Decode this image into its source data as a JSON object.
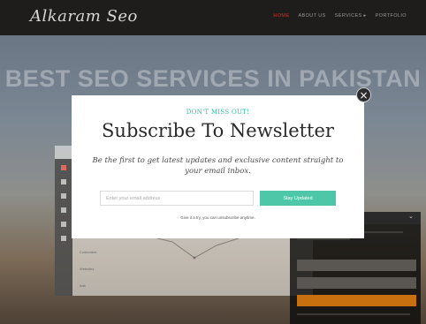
{
  "site": {
    "logo": "Alkaram Seo",
    "nav": [
      {
        "label": "HOME"
      },
      {
        "label": "ABOUT US"
      },
      {
        "label": "SERVICES ▸"
      },
      {
        "label": "PORTFOLIO"
      }
    ],
    "hero_title": "BEST SEO SERVICES IN PAKISTAN"
  },
  "popup": {
    "kicker": "DON'T MISS OUT!",
    "title": "Subscribe To Newsletter",
    "description": "Be the first to get latest updates and exclusive content straight to your email inbox.",
    "email_placeholder": "Enter your email address",
    "submit_label": "Stay Updated",
    "note": "Give it a try, you can unsubscribe anytime.",
    "close_symbol": "×"
  },
  "background_dashboard": {
    "rows": [
      "Customers",
      "Websites",
      "Ads"
    ]
  },
  "colors": {
    "accent": "#4ec7a8",
    "nav_active": "#c0392b",
    "panel_button": "#c8700f"
  }
}
